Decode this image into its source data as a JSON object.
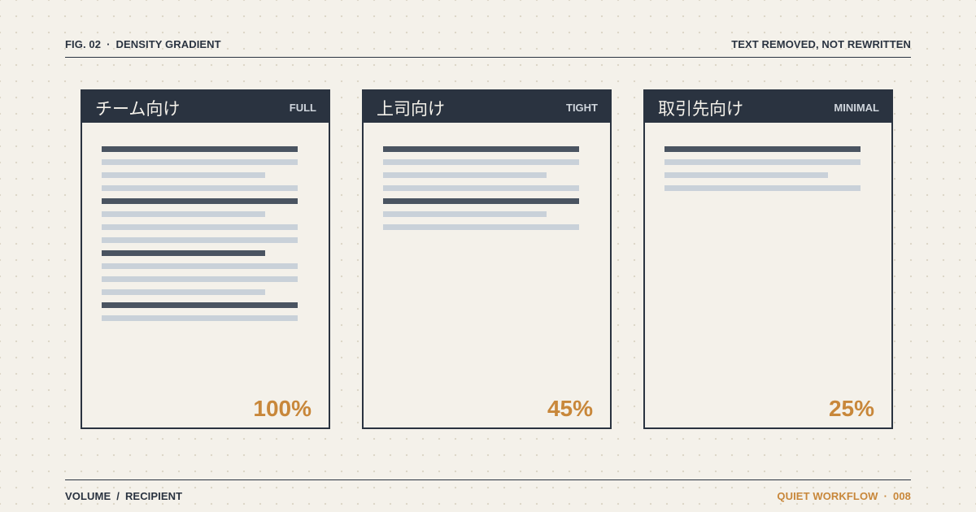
{
  "header": {
    "fig": "FIG. 02",
    "dot": "·",
    "title": "DENSITY GRADIENT",
    "right": "TEXT REMOVED, NOT REWRITTEN"
  },
  "footer": {
    "left_a": "VOLUME",
    "slash": "/",
    "left_b": "RECIPIENT",
    "right_a": "QUIET WORKFLOW",
    "dot": "·",
    "right_b": "008"
  },
  "colors": {
    "accent": "#c8873a",
    "ink": "#2a3340",
    "paper": "#f4f1ea",
    "line_dark": "#4a5461",
    "line_light": "#c9d1d9"
  },
  "cards": [
    {
      "title": "チーム向け",
      "tag": "FULL",
      "percent": "100%",
      "lines": [
        {
          "tone": "dark",
          "length": "full"
        },
        {
          "tone": "light",
          "length": "full"
        },
        {
          "tone": "light",
          "length": "short"
        },
        {
          "tone": "light",
          "length": "full"
        },
        {
          "tone": "dark",
          "length": "full"
        },
        {
          "tone": "light",
          "length": "short"
        },
        {
          "tone": "light",
          "length": "full"
        },
        {
          "tone": "light",
          "length": "full"
        },
        {
          "tone": "dark",
          "length": "short"
        },
        {
          "tone": "light",
          "length": "full"
        },
        {
          "tone": "light",
          "length": "full"
        },
        {
          "tone": "light",
          "length": "short"
        },
        {
          "tone": "dark",
          "length": "full"
        },
        {
          "tone": "light",
          "length": "full"
        }
      ]
    },
    {
      "title": "上司向け",
      "tag": "TIGHT",
      "percent": "45%",
      "lines": [
        {
          "tone": "dark",
          "length": "full"
        },
        {
          "tone": "light",
          "length": "full"
        },
        {
          "tone": "light",
          "length": "short"
        },
        {
          "tone": "light",
          "length": "full"
        },
        {
          "tone": "dark",
          "length": "full"
        },
        {
          "tone": "light",
          "length": "short"
        },
        {
          "tone": "light",
          "length": "full"
        }
      ]
    },
    {
      "title": "取引先向け",
      "tag": "MINIMAL",
      "percent": "25%",
      "lines": [
        {
          "tone": "dark",
          "length": "full"
        },
        {
          "tone": "light",
          "length": "full"
        },
        {
          "tone": "light",
          "length": "short"
        },
        {
          "tone": "light",
          "length": "full"
        }
      ]
    }
  ]
}
